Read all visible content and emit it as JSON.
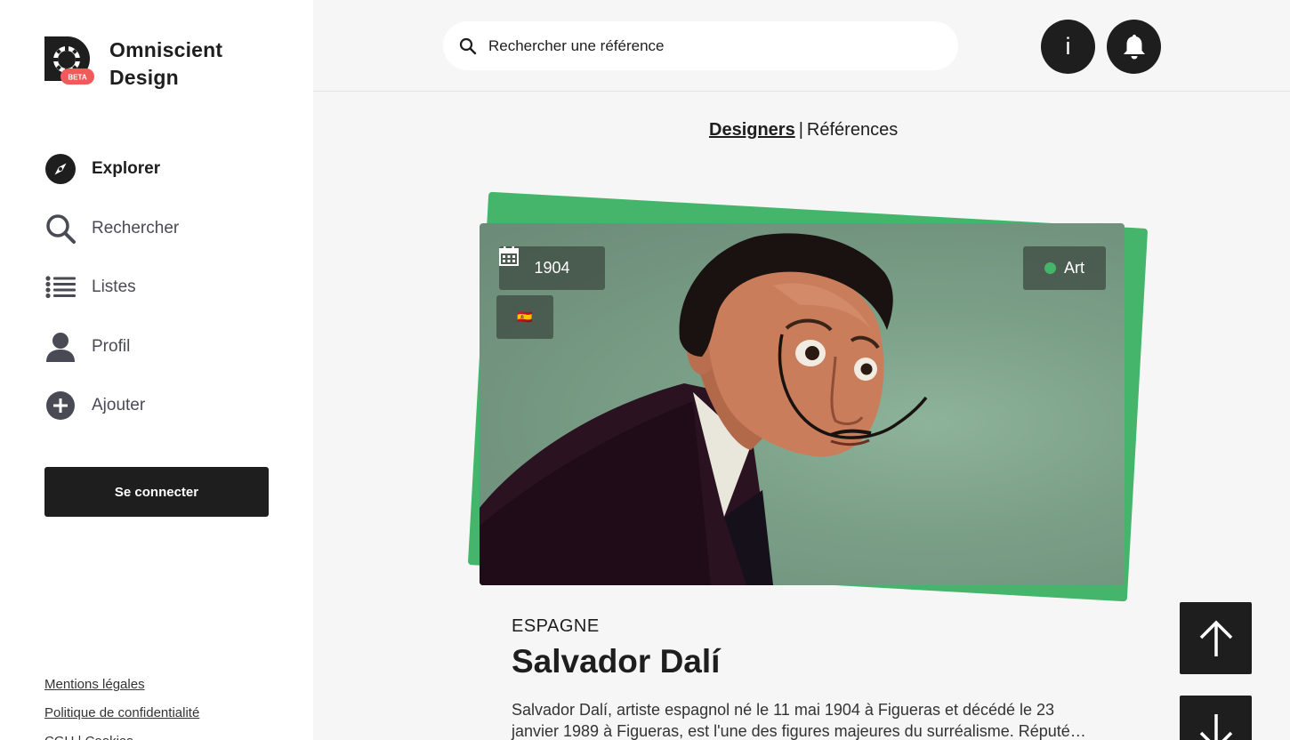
{
  "brand": {
    "line1": "Omniscient",
    "line2": "Design",
    "badge": "BETA"
  },
  "nav": {
    "items": [
      {
        "label": "Explorer",
        "icon": "compass-icon",
        "active": true
      },
      {
        "label": "Rechercher",
        "icon": "search-icon",
        "active": false
      },
      {
        "label": "Listes",
        "icon": "list-icon",
        "active": false
      },
      {
        "label": "Profil",
        "icon": "user-icon",
        "active": false
      },
      {
        "label": "Ajouter",
        "icon": "plus-circle-icon",
        "active": false
      }
    ]
  },
  "auth": {
    "login_label": "Se connecter"
  },
  "footer": {
    "links": [
      "Mentions légales",
      "Politique de confidentialité",
      "CGU | Cookies"
    ]
  },
  "search": {
    "placeholder": "Rechercher une référence"
  },
  "header": {
    "info_label": "i"
  },
  "tabs": {
    "designers": "Designers",
    "separator": "|",
    "references": "Références"
  },
  "card": {
    "year": "1904",
    "flag": "🇪🇸",
    "category": "Art",
    "category_color": "#45b56b",
    "country": "ESPAGNE",
    "name": "Salvador Dalí",
    "bio": "Salvador Dalí, artiste espagnol né le 11 mai 1904 à Figueras et décédé le 23 janvier 1989 à Figueras, est l'une des figures majeures du surréalisme. Réputé…"
  },
  "colors": {
    "accent": "#45b56b",
    "dark": "#1e1e1e",
    "badge": "#f05a5a"
  }
}
